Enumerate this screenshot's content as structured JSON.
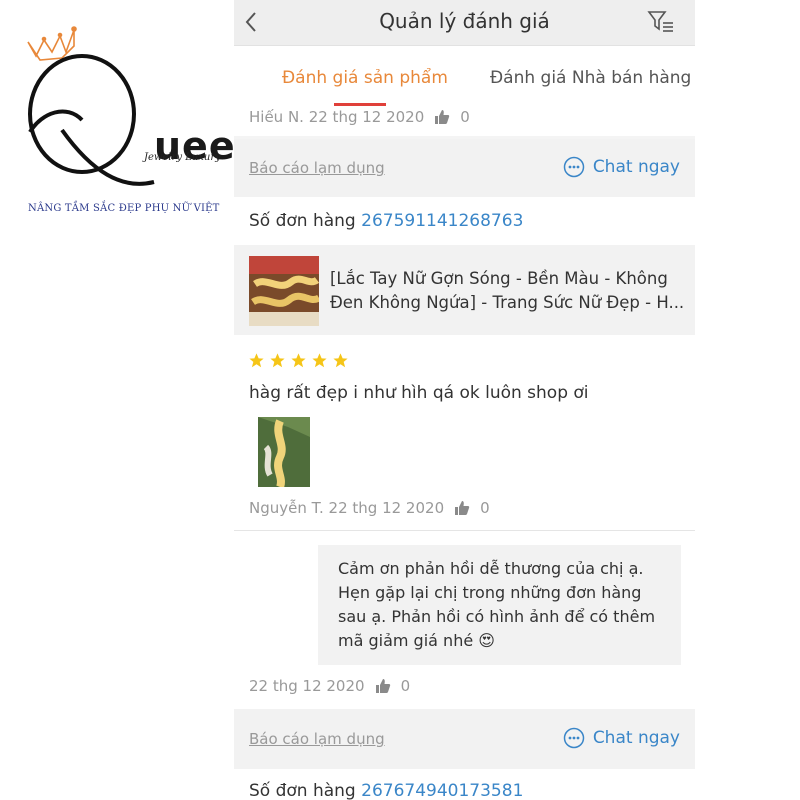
{
  "logo": {
    "letters": "ueen",
    "subtitle": "Jewelry Luxury",
    "tagline": "NÂNG TẦM SẮC ĐẸP PHỤ NỮ VIỆT",
    "brand_color": "#2b3a8c",
    "crown_color": "#e8883a"
  },
  "nav": {
    "title": "Quản lý đánh giá",
    "back_icon": "chevron-left-icon",
    "filter_icon": "filter-list-icon"
  },
  "tabs": [
    {
      "label": "Đánh giá sản phẩm",
      "active": true
    },
    {
      "label": "Đánh giá Nhà bán hàng",
      "active": false
    }
  ],
  "review1": {
    "meta": {
      "author_date": "Hiếu N. 22 thg 12 2020",
      "likes": "0"
    },
    "report_label": "Báo cáo lạm dụng",
    "chat_label": "Chat ngay"
  },
  "review2": {
    "order_label": "Số đơn hàng",
    "order_number": "267591141268763",
    "product_name": "[Lắc Tay Nữ Gợn Sóng - Bền Màu - Không Đen Không Ngứa] - Trang Sức Nữ Đẹp - H...",
    "rating": 5,
    "text": "hàg rất đẹp i như hìh qá ok luôn shop ơi",
    "meta": {
      "author_date": "Nguyễn T. 22 thg 12 2020",
      "likes": "0"
    },
    "reply": "Cảm ơn phản hồi dễ thương của chị ạ. Hẹn gặp lại chị trong những đơn hàng sau ạ. Phản hồi có hình ảnh để có thêm mã giảm giá nhé 😍",
    "reply_meta": {
      "date": "22 thg 12 2020",
      "likes": "0"
    },
    "report_label": "Báo cáo lạm dụng",
    "chat_label": "Chat ngay"
  },
  "review3": {
    "order_label": "Số đơn hàng",
    "order_number": "267674940173581"
  },
  "colors": {
    "accent_orange": "#e8883a",
    "link_blue": "#3a86c8",
    "star": "#f5c518",
    "tab_underline": "#e0403a"
  }
}
